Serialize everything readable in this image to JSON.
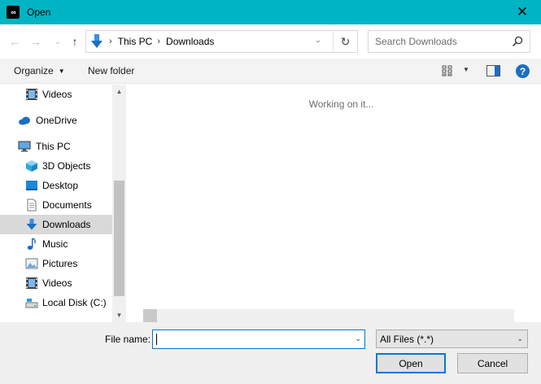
{
  "window": {
    "title": "Open",
    "close_glyph": "✕"
  },
  "toolbar": {
    "back_glyph": "←",
    "forward_glyph": "→",
    "recent_glyph": "⌄",
    "up_glyph": "↑",
    "refresh_glyph": "↻"
  },
  "address": {
    "segments": [
      "This PC",
      "Downloads"
    ],
    "separator": "›"
  },
  "search": {
    "placeholder": "Search Downloads"
  },
  "commands": {
    "organize": "Organize",
    "new_folder": "New folder"
  },
  "nav": {
    "items": [
      {
        "label": "Videos",
        "icon": "video-icon"
      },
      {
        "label": "OneDrive",
        "icon": "cloud-icon"
      },
      {
        "label": "This PC",
        "icon": "computer-icon"
      },
      {
        "label": "3D Objects",
        "icon": "cube-icon"
      },
      {
        "label": "Desktop",
        "icon": "desktop-icon"
      },
      {
        "label": "Documents",
        "icon": "document-icon"
      },
      {
        "label": "Downloads",
        "icon": "download-icon"
      },
      {
        "label": "Music",
        "icon": "music-icon"
      },
      {
        "label": "Pictures",
        "icon": "picture-icon"
      },
      {
        "label": "Videos",
        "icon": "video-icon"
      },
      {
        "label": "Local Disk (C:)",
        "icon": "drive-icon"
      }
    ],
    "selected_label": "Downloads"
  },
  "content": {
    "status": "Working on it..."
  },
  "file_name": {
    "label": "File name:",
    "value": ""
  },
  "file_type": {
    "selected": "All Files (*.*)"
  },
  "buttons": {
    "open": "Open",
    "cancel": "Cancel"
  },
  "colors": {
    "titlebar": "#00b4c4",
    "accent": "#0078d7",
    "selected_row": "#d9d9d9"
  }
}
